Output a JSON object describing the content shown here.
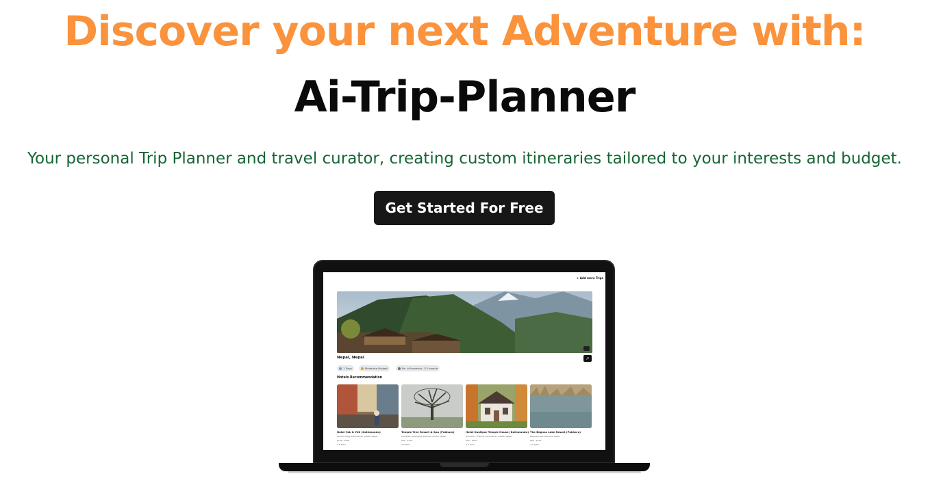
{
  "hero": {
    "title": "Discover your next Adventure with:",
    "subtitle": "Ai-Trip-Planner",
    "description": "Your personal Trip Planner and travel curator, creating custom itineraries tailored to your interests and budget.",
    "cta_label": "Get Started For Free"
  },
  "colors": {
    "title_orange": "#fb923c",
    "description_green": "#166534",
    "cta_background": "#171717"
  },
  "preview": {
    "add_trips_label": "+ Add more Trips",
    "place_title": "Nepal, Nepal",
    "chips": [
      {
        "label": "1 Days",
        "icon": "calendar-icon"
      },
      {
        "label": "Moderate Budget",
        "icon": "money-icon"
      },
      {
        "label": "No. of travelers: 3-5 people",
        "icon": "people-icon"
      }
    ],
    "section_title": "Hotels Recommendation",
    "hotels": [
      {
        "name": "Hotel Yak & Yeti (Kathmandu)",
        "address": "Durbar Marg, Kathmandu 44600, Nepal",
        "price": "$100 - $200",
        "rating": "4.5 stars"
      },
      {
        "name": "Temple Tree Resort & Spa (Pokhara)",
        "address": "Lakeside, Gaurighat, Pokhara 33700, Nepal",
        "price": "$80 - $150",
        "rating": "4.4 stars"
      },
      {
        "name": "Hotel Kantipur Temple House (Kathmandu)",
        "address": "Jhochhen, Thamel, Kathmandu 44600, Nepal",
        "price": "$50 - $100",
        "rating": "4.2 stars"
      },
      {
        "name": "The Begnas Lake Resort (Pokhara)",
        "address": "Begnas Lake, Pokhara, Nepal",
        "price": "$60 - $120",
        "rating": "4.3 stars"
      }
    ]
  }
}
